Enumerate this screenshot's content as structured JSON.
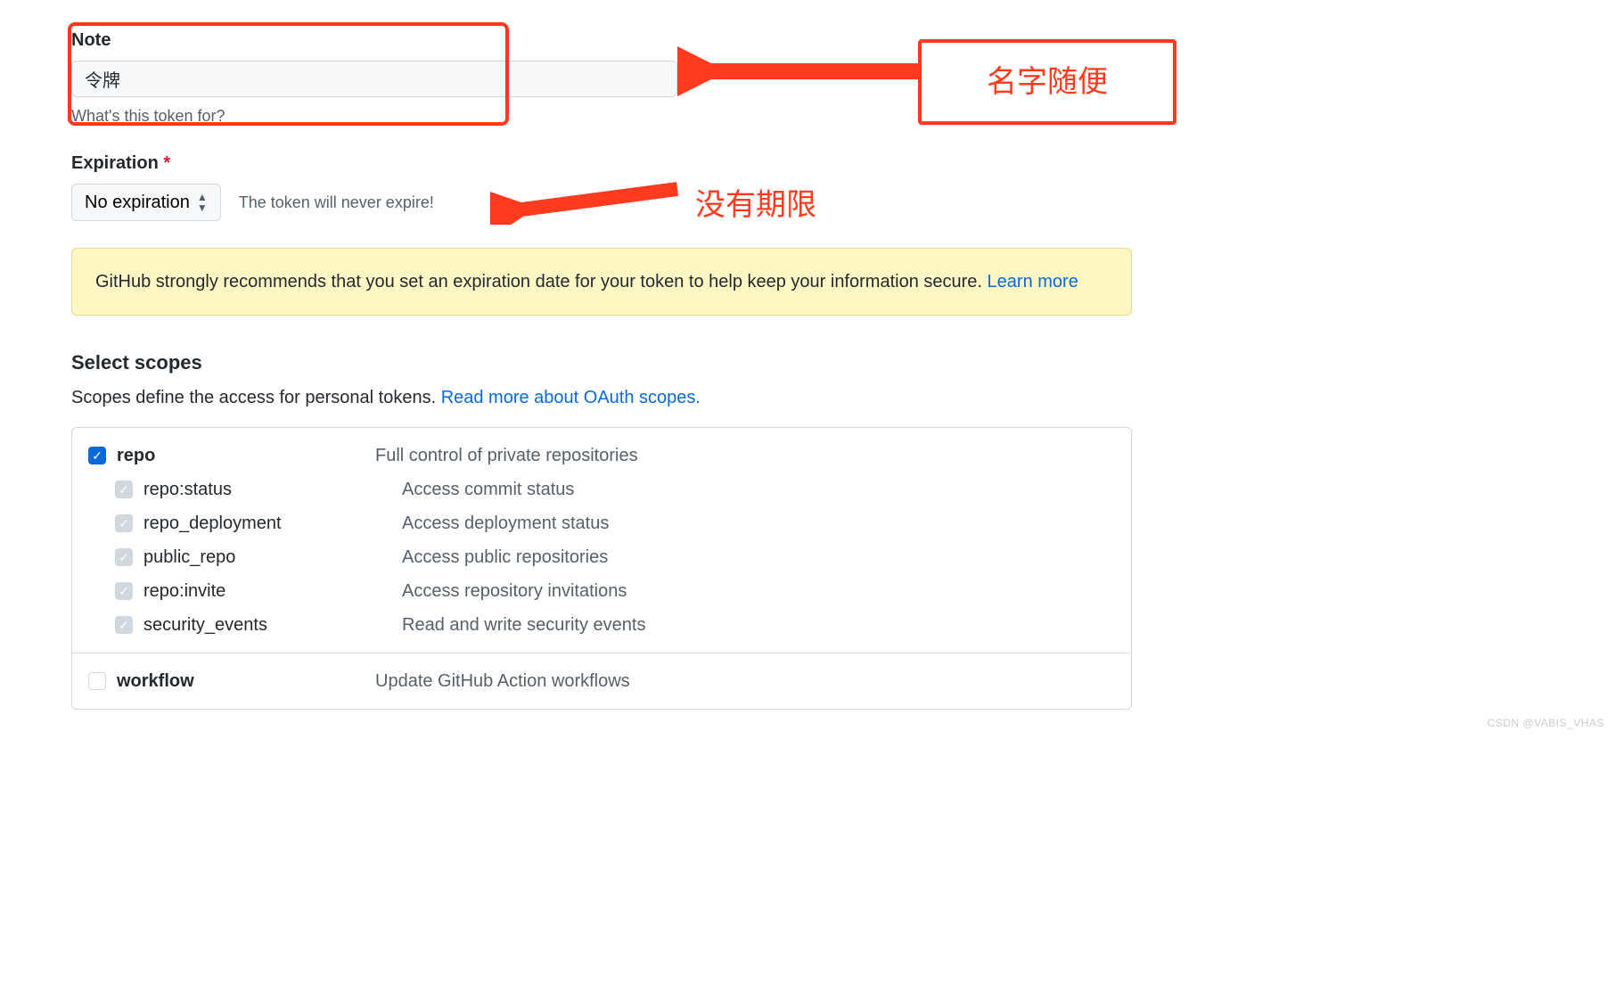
{
  "note": {
    "label": "Note",
    "value": "令牌",
    "hint": "What's this token for?"
  },
  "expiration": {
    "label": "Expiration",
    "selected": "No expiration",
    "message": "The token will never expire!"
  },
  "warning": {
    "text": "GitHub strongly recommends that you set an expiration date for your token to help keep your information secure.",
    "link": "Learn more"
  },
  "scopes": {
    "heading": "Select scopes",
    "sub_prefix": "Scopes define the access for personal tokens. ",
    "sub_link": "Read more about OAuth scopes.",
    "groups": [
      {
        "parent": {
          "name": "repo",
          "desc": "Full control of private repositories",
          "state": "checked"
        },
        "children": [
          {
            "name": "repo:status",
            "desc": "Access commit status",
            "state": "dim"
          },
          {
            "name": "repo_deployment",
            "desc": "Access deployment status",
            "state": "dim"
          },
          {
            "name": "public_repo",
            "desc": "Access public repositories",
            "state": "dim"
          },
          {
            "name": "repo:invite",
            "desc": "Access repository invitations",
            "state": "dim"
          },
          {
            "name": "security_events",
            "desc": "Read and write security events",
            "state": "dim"
          }
        ]
      },
      {
        "parent": {
          "name": "workflow",
          "desc": "Update GitHub Action workflows",
          "state": "empty"
        },
        "children": []
      }
    ]
  },
  "annotations": {
    "callout1": "名字随便",
    "callout2": "没有期限"
  },
  "watermark": "CSDN @VABIS_VHAS"
}
